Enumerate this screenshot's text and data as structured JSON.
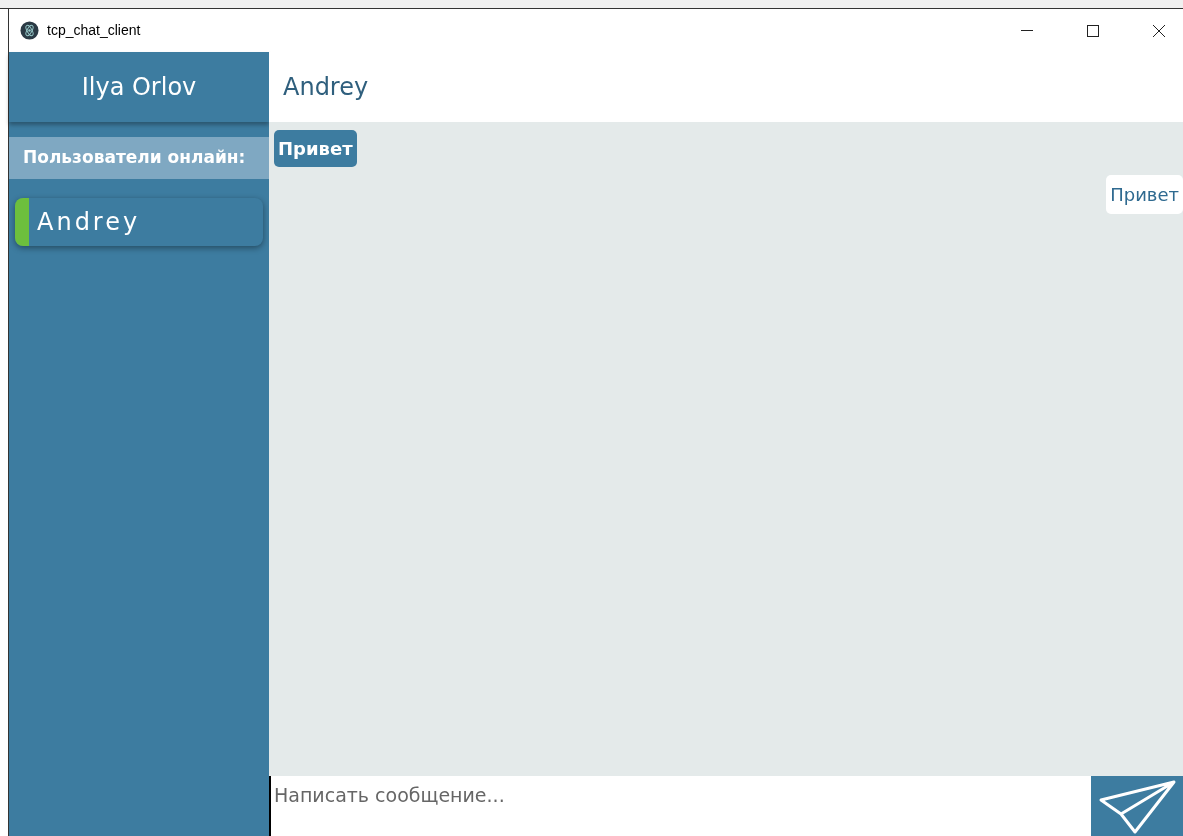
{
  "window": {
    "title": "tcp_chat_client"
  },
  "sidebar": {
    "current_user": "Ilya Orlov",
    "online_heading": "Пользователи онлайн:",
    "users": [
      {
        "name": "Andrey",
        "online": true
      }
    ]
  },
  "chat": {
    "title": "Andrey",
    "messages": [
      {
        "kind": "incoming",
        "text": "Привет"
      },
      {
        "kind": "outgoing",
        "text": "Привет"
      }
    ]
  },
  "composer": {
    "placeholder": "Написать сообщение..."
  }
}
